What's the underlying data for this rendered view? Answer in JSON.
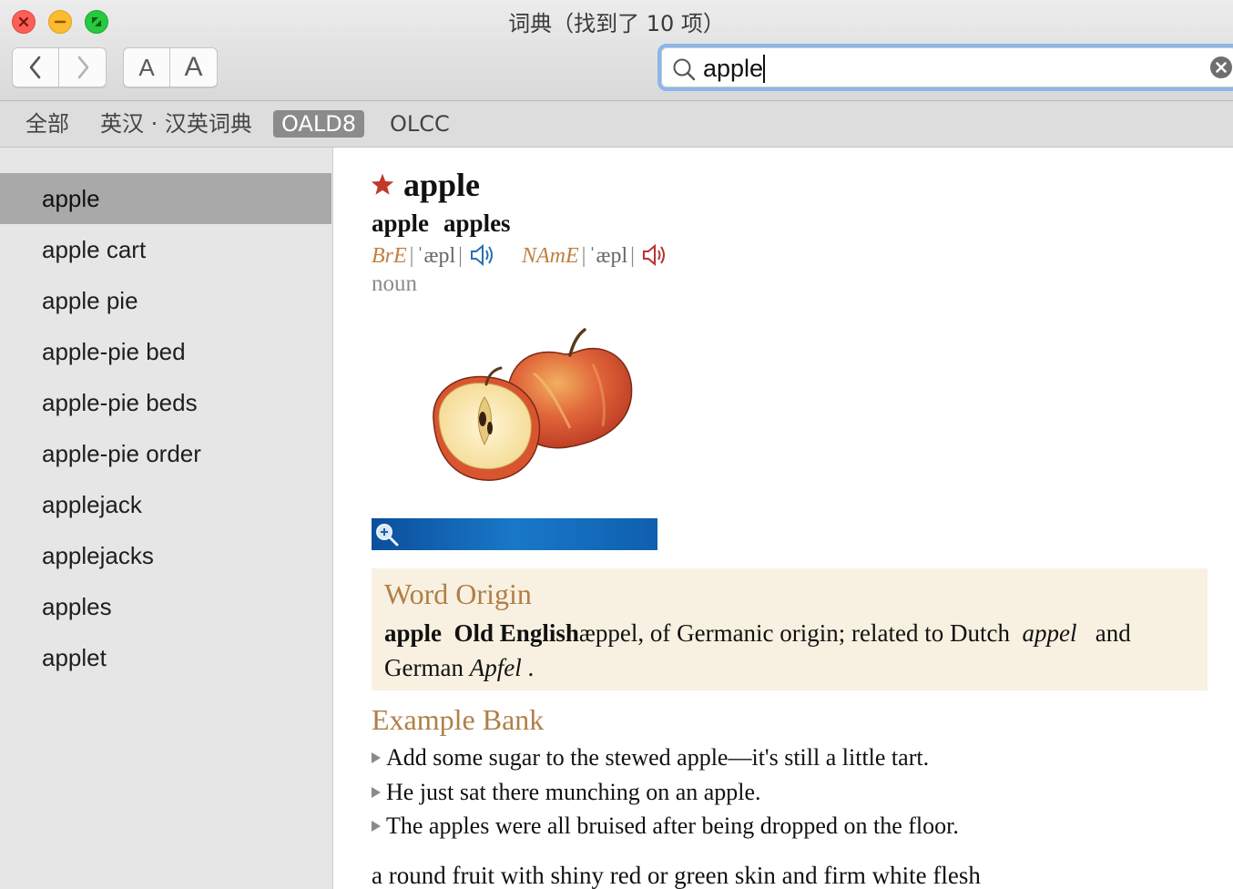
{
  "window": {
    "title": "词典（找到了 10 项）"
  },
  "toolbar": {
    "small_font_label": "A",
    "large_font_label": "A"
  },
  "search": {
    "value": "apple"
  },
  "scopes": [
    {
      "label": "全部",
      "active": false
    },
    {
      "label": "英汉 · 汉英词典",
      "active": false
    },
    {
      "label": "OALD8",
      "active": true
    },
    {
      "label": "OLCC",
      "active": false
    }
  ],
  "results": [
    "apple",
    "apple cart",
    "apple pie",
    "apple-pie bed",
    "apple-pie beds",
    "apple-pie order",
    "applejack",
    "applejacks",
    "apples",
    "applet"
  ],
  "selected_result": "apple",
  "entry": {
    "headword": "apple",
    "forms": [
      "apple",
      "apples"
    ],
    "pron_bre_label": "BrE",
    "pron_bre_ipa": "ˈæpl",
    "pron_name_label": "NAmE",
    "pron_name_ipa": "ˈæpl",
    "part_of_speech": "noun",
    "origin": {
      "title": "Word Origin",
      "word": "apple",
      "lang": "Old English",
      "text1": "æppel, of Germanic origin; related to Dutch",
      "dutch": "appel",
      "and": "and",
      "german_prefix": "German",
      "german": "Apfel",
      "end": "."
    },
    "examples_title": "Example Bank",
    "examples": [
      "Add some sugar to the stewed apple—it's still a little tart.",
      "He just sat there munching on an apple.",
      "The apples were all bruised after being dropped on the floor."
    ],
    "definition": "a round fruit with shiny red or green skin and firm white flesh"
  },
  "colors": {
    "accent_brown": "#b07f47",
    "origin_bg": "#f8f1e1",
    "star_red": "#c0392b",
    "selection_gray": "#a9a9a9"
  }
}
